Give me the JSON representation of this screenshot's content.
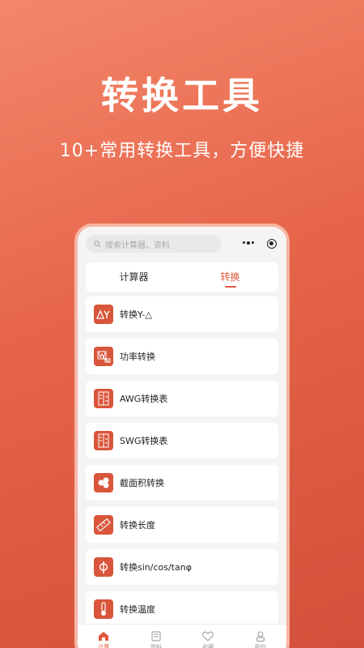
{
  "hero": {
    "title": "转换工具",
    "subtitle": "10+常用转换工具，方便快捷"
  },
  "search": {
    "placeholder": "搜索计算器、资料"
  },
  "tabs": [
    {
      "label": "计算器",
      "active": false
    },
    {
      "label": "转换",
      "active": true
    }
  ],
  "items": [
    {
      "label": "转换Y-△",
      "icon": "delta-y-icon"
    },
    {
      "label": "功率转换",
      "icon": "power-w-icon"
    },
    {
      "label": "AWG转换表",
      "icon": "awg-ruler-icon"
    },
    {
      "label": "SWG转换表",
      "icon": "swg-ruler-icon"
    },
    {
      "label": "截面积转换",
      "icon": "cross-section-icon"
    },
    {
      "label": "转换长度",
      "icon": "tape-measure-icon"
    },
    {
      "label": "转换sin/cos/tanφ",
      "icon": "phi-icon"
    },
    {
      "label": "转换温度",
      "icon": "thermometer-icon"
    }
  ],
  "tabbar": [
    {
      "label": "计算",
      "icon": "home-icon",
      "active": true
    },
    {
      "label": "资料",
      "icon": "document-icon",
      "active": false
    },
    {
      "label": "收藏",
      "icon": "heart-icon",
      "active": false
    },
    {
      "label": "我的",
      "icon": "user-icon",
      "active": false
    }
  ],
  "colors": {
    "accent": "#e0573c",
    "background_start": "#f3876a",
    "background_end": "#d4503a"
  }
}
